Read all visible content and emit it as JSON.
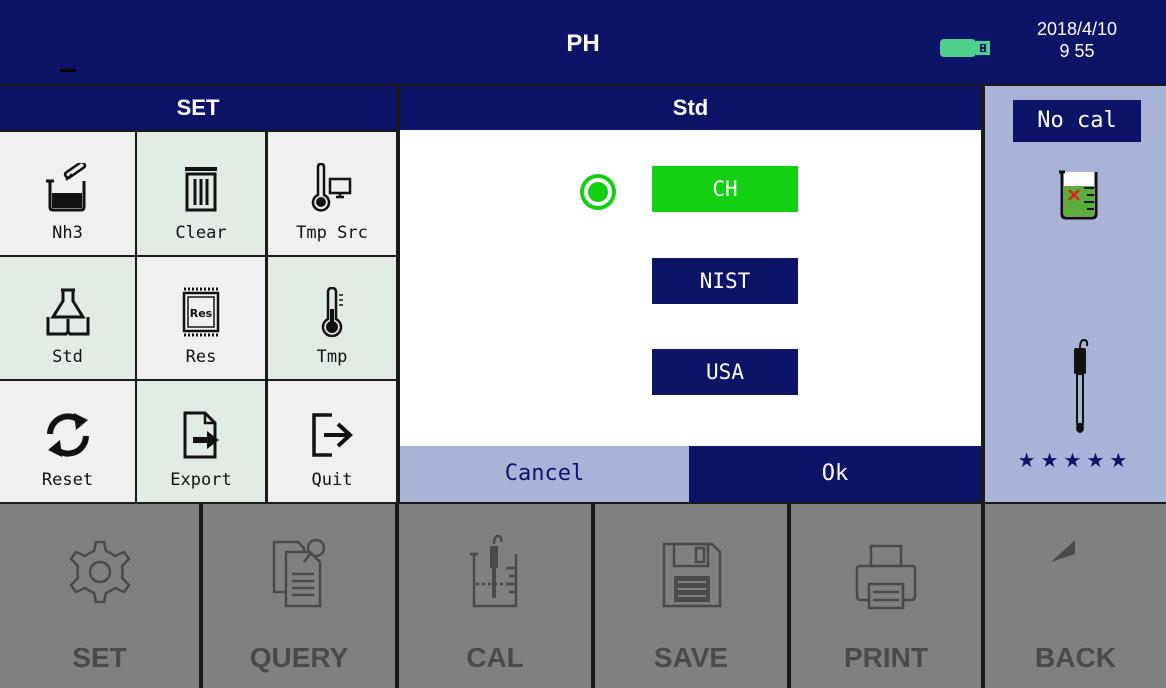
{
  "header": {
    "title": "PH",
    "date": "2018/4/10",
    "time": "9 55",
    "usb_icon": "usb-icon"
  },
  "set_panel": {
    "title": "SET",
    "items": [
      {
        "label": "Nh3",
        "icon": "beaker-dropper-icon"
      },
      {
        "label": "Clear",
        "icon": "trash-icon"
      },
      {
        "label": "Tmp Src",
        "icon": "thermometer-monitor-icon"
      },
      {
        "label": "Std",
        "icon": "book-flask-icon"
      },
      {
        "label": "Res",
        "icon": "res-chip-icon"
      },
      {
        "label": "Tmp",
        "icon": "thermometer-icon"
      },
      {
        "label": "Reset",
        "icon": "refresh-icon"
      },
      {
        "label": "Export",
        "icon": "export-file-icon"
      },
      {
        "label": "Quit",
        "icon": "exit-icon"
      }
    ]
  },
  "dialog": {
    "title": "Std",
    "options": [
      "CH",
      "NIST",
      "USA"
    ],
    "selected": "CH",
    "cancel_label": "Cancel",
    "ok_label": "Ok"
  },
  "status_panel": {
    "cal_status": "No cal",
    "stars": "★★★★★",
    "rating": 5
  },
  "toolbar": {
    "items": [
      {
        "label": "SET",
        "icon": "gear-icon"
      },
      {
        "label": "QUERY",
        "icon": "query-document-icon"
      },
      {
        "label": "CAL",
        "icon": "calibration-beaker-icon"
      },
      {
        "label": "SAVE",
        "icon": "floppy-disk-icon"
      },
      {
        "label": "PRINT",
        "icon": "printer-icon"
      },
      {
        "label": "BACK",
        "icon": "back-arrow-icon"
      }
    ]
  },
  "colors": {
    "navy": "#0c1468",
    "green": "#13d013",
    "lavender": "#a9b3d8",
    "toolbar_gray": "#808080"
  }
}
